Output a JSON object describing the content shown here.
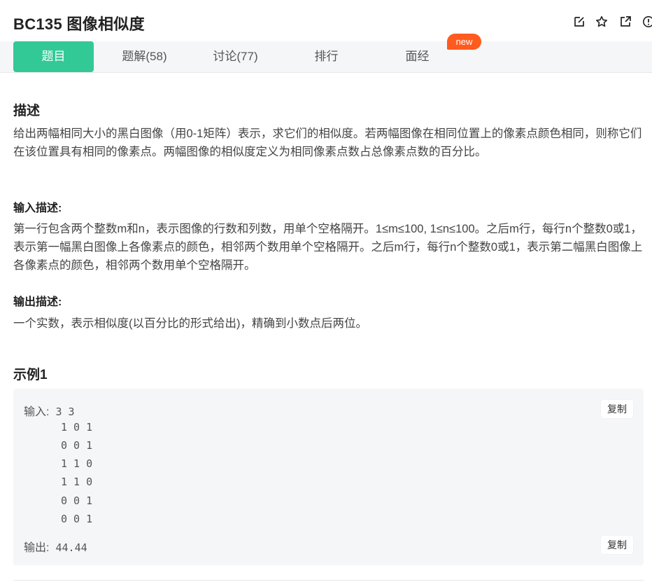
{
  "problem": {
    "title": "BC135  图像相似度"
  },
  "header_icons": [
    "edit-icon",
    "star-icon",
    "share-icon",
    "info-icon"
  ],
  "tabs": [
    {
      "label": "题目",
      "active": true
    },
    {
      "label": "题解(58)"
    },
    {
      "label": "讨论(77)"
    },
    {
      "label": "排行"
    },
    {
      "label": "面经"
    }
  ],
  "badge": "new",
  "description": {
    "heading": "描述",
    "text": "给出两幅相同大小的黑白图像（用0-1矩阵）表示，求它们的相似度。若两幅图像在相同位置上的像素点颜色相同，则称它们在该位置具有相同的像素点。两幅图像的相似度定义为相同像素点数占总像素点数的百分比。"
  },
  "input_desc": {
    "heading": "输入描述:",
    "text": "第一行包含两个整数m和n，表示图像的行数和列数，用单个空格隔开。1≤m≤100, 1≤n≤100。之后m行，每行n个整数0或1，表示第一幅黑白图像上各像素点的颜色，相邻两个数用单个空格隔开。之后m行，每行n个整数0或1，表示第二幅黑白图像上各像素点的颜色，相邻两个数用单个空格隔开。"
  },
  "output_desc": {
    "heading": "输出描述:",
    "text": "一个实数，表示相似度(以百分比的形式给出)，精确到小数点后两位。"
  },
  "example": {
    "heading": "示例1",
    "input_label": "输入:",
    "input_lines": [
      "3 3",
      "1 0 1",
      "0 0 1",
      "1 1 0",
      "1 1 0",
      "0 0 1",
      "0 0 1"
    ],
    "output_label": "输出:",
    "output_value": "44.44",
    "copy_label": "复制"
  },
  "colors": {
    "accent": "#32c997",
    "badge": "#ff5b1e",
    "tabbar_bg": "#f5f6f8"
  }
}
